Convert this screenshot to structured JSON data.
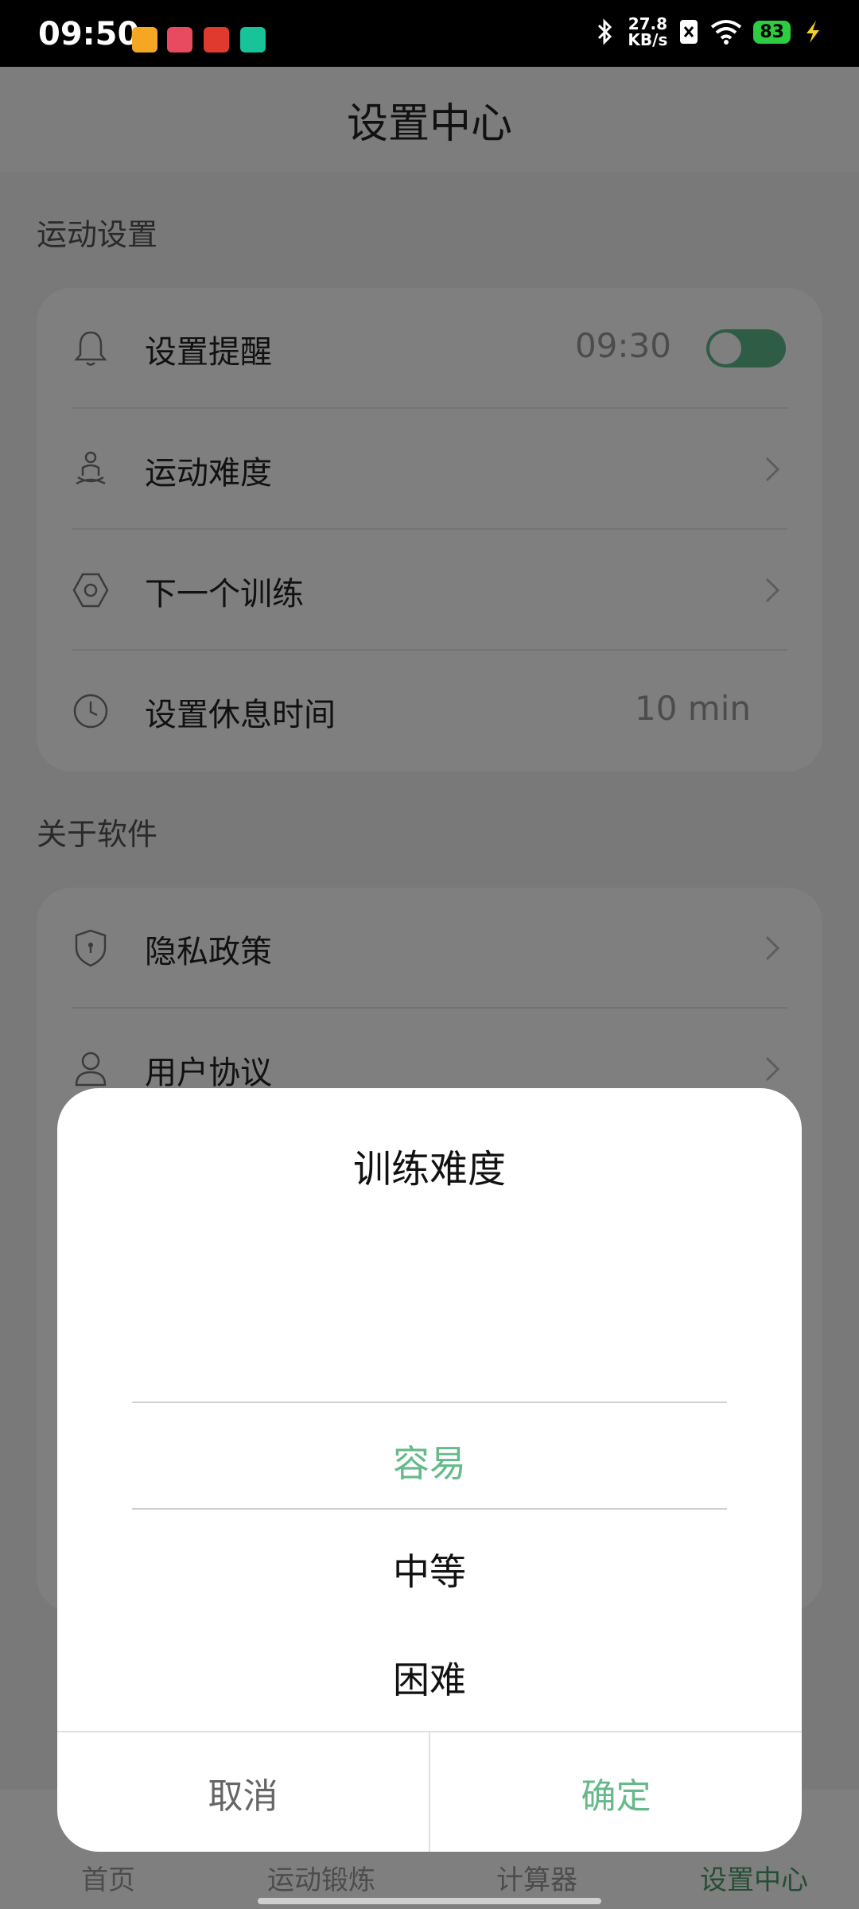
{
  "status_bar": {
    "time": "09:50",
    "net_speed_value": "27.8",
    "net_speed_unit": "KB/s",
    "battery": "83"
  },
  "header": {
    "title": "设置中心"
  },
  "sections": [
    {
      "title": "运动设置"
    },
    {
      "title": "关于软件"
    }
  ],
  "settings": {
    "reminder": {
      "label": "设置提醒",
      "value": "09:30",
      "toggle_on": true
    },
    "difficulty": {
      "label": "运动难度"
    },
    "next_training": {
      "label": "下一个训练"
    },
    "rest_time": {
      "label": "设置休息时间",
      "value": "10 min"
    },
    "privacy": {
      "label": "隐私政策"
    },
    "user_agreement": {
      "label": "用户协议"
    }
  },
  "bottom_nav": [
    {
      "label": "首页"
    },
    {
      "label": "运动锻炼"
    },
    {
      "label": "计算器"
    },
    {
      "label": "设置中心",
      "active": true
    }
  ],
  "dialog": {
    "title": "训练难度",
    "options": [
      {
        "label": "容易",
        "selected": true
      },
      {
        "label": "中等"
      },
      {
        "label": "困难"
      }
    ],
    "cancel_label": "取消",
    "confirm_label": "确定"
  },
  "colors": {
    "accent": "#66b98a",
    "overlay": "rgba(0,0,0,0.5)"
  }
}
